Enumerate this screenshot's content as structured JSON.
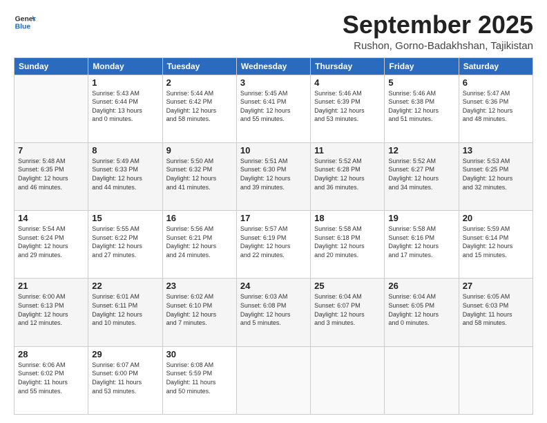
{
  "logo": {
    "line1": "General",
    "line2": "Blue"
  },
  "title": "September 2025",
  "location": "Rushon, Gorno-Badakhshan, Tajikistan",
  "days_of_week": [
    "Sunday",
    "Monday",
    "Tuesday",
    "Wednesday",
    "Thursday",
    "Friday",
    "Saturday"
  ],
  "weeks": [
    [
      {
        "day": "",
        "info": ""
      },
      {
        "day": "1",
        "info": "Sunrise: 5:43 AM\nSunset: 6:44 PM\nDaylight: 13 hours\nand 0 minutes."
      },
      {
        "day": "2",
        "info": "Sunrise: 5:44 AM\nSunset: 6:42 PM\nDaylight: 12 hours\nand 58 minutes."
      },
      {
        "day": "3",
        "info": "Sunrise: 5:45 AM\nSunset: 6:41 PM\nDaylight: 12 hours\nand 55 minutes."
      },
      {
        "day": "4",
        "info": "Sunrise: 5:46 AM\nSunset: 6:39 PM\nDaylight: 12 hours\nand 53 minutes."
      },
      {
        "day": "5",
        "info": "Sunrise: 5:46 AM\nSunset: 6:38 PM\nDaylight: 12 hours\nand 51 minutes."
      },
      {
        "day": "6",
        "info": "Sunrise: 5:47 AM\nSunset: 6:36 PM\nDaylight: 12 hours\nand 48 minutes."
      }
    ],
    [
      {
        "day": "7",
        "info": "Sunrise: 5:48 AM\nSunset: 6:35 PM\nDaylight: 12 hours\nand 46 minutes."
      },
      {
        "day": "8",
        "info": "Sunrise: 5:49 AM\nSunset: 6:33 PM\nDaylight: 12 hours\nand 44 minutes."
      },
      {
        "day": "9",
        "info": "Sunrise: 5:50 AM\nSunset: 6:32 PM\nDaylight: 12 hours\nand 41 minutes."
      },
      {
        "day": "10",
        "info": "Sunrise: 5:51 AM\nSunset: 6:30 PM\nDaylight: 12 hours\nand 39 minutes."
      },
      {
        "day": "11",
        "info": "Sunrise: 5:52 AM\nSunset: 6:28 PM\nDaylight: 12 hours\nand 36 minutes."
      },
      {
        "day": "12",
        "info": "Sunrise: 5:52 AM\nSunset: 6:27 PM\nDaylight: 12 hours\nand 34 minutes."
      },
      {
        "day": "13",
        "info": "Sunrise: 5:53 AM\nSunset: 6:25 PM\nDaylight: 12 hours\nand 32 minutes."
      }
    ],
    [
      {
        "day": "14",
        "info": "Sunrise: 5:54 AM\nSunset: 6:24 PM\nDaylight: 12 hours\nand 29 minutes."
      },
      {
        "day": "15",
        "info": "Sunrise: 5:55 AM\nSunset: 6:22 PM\nDaylight: 12 hours\nand 27 minutes."
      },
      {
        "day": "16",
        "info": "Sunrise: 5:56 AM\nSunset: 6:21 PM\nDaylight: 12 hours\nand 24 minutes."
      },
      {
        "day": "17",
        "info": "Sunrise: 5:57 AM\nSunset: 6:19 PM\nDaylight: 12 hours\nand 22 minutes."
      },
      {
        "day": "18",
        "info": "Sunrise: 5:58 AM\nSunset: 6:18 PM\nDaylight: 12 hours\nand 20 minutes."
      },
      {
        "day": "19",
        "info": "Sunrise: 5:58 AM\nSunset: 6:16 PM\nDaylight: 12 hours\nand 17 minutes."
      },
      {
        "day": "20",
        "info": "Sunrise: 5:59 AM\nSunset: 6:14 PM\nDaylight: 12 hours\nand 15 minutes."
      }
    ],
    [
      {
        "day": "21",
        "info": "Sunrise: 6:00 AM\nSunset: 6:13 PM\nDaylight: 12 hours\nand 12 minutes."
      },
      {
        "day": "22",
        "info": "Sunrise: 6:01 AM\nSunset: 6:11 PM\nDaylight: 12 hours\nand 10 minutes."
      },
      {
        "day": "23",
        "info": "Sunrise: 6:02 AM\nSunset: 6:10 PM\nDaylight: 12 hours\nand 7 minutes."
      },
      {
        "day": "24",
        "info": "Sunrise: 6:03 AM\nSunset: 6:08 PM\nDaylight: 12 hours\nand 5 minutes."
      },
      {
        "day": "25",
        "info": "Sunrise: 6:04 AM\nSunset: 6:07 PM\nDaylight: 12 hours\nand 3 minutes."
      },
      {
        "day": "26",
        "info": "Sunrise: 6:04 AM\nSunset: 6:05 PM\nDaylight: 12 hours\nand 0 minutes."
      },
      {
        "day": "27",
        "info": "Sunrise: 6:05 AM\nSunset: 6:03 PM\nDaylight: 11 hours\nand 58 minutes."
      }
    ],
    [
      {
        "day": "28",
        "info": "Sunrise: 6:06 AM\nSunset: 6:02 PM\nDaylight: 11 hours\nand 55 minutes."
      },
      {
        "day": "29",
        "info": "Sunrise: 6:07 AM\nSunset: 6:00 PM\nDaylight: 11 hours\nand 53 minutes."
      },
      {
        "day": "30",
        "info": "Sunrise: 6:08 AM\nSunset: 5:59 PM\nDaylight: 11 hours\nand 50 minutes."
      },
      {
        "day": "",
        "info": ""
      },
      {
        "day": "",
        "info": ""
      },
      {
        "day": "",
        "info": ""
      },
      {
        "day": "",
        "info": ""
      }
    ]
  ]
}
